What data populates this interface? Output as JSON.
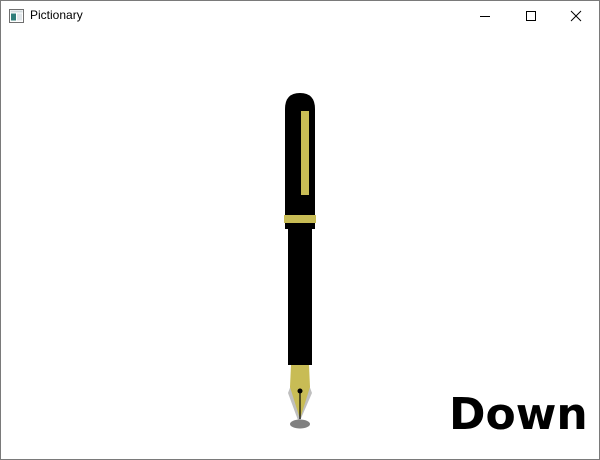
{
  "window": {
    "title": "Pictionary",
    "icons": {
      "app": "app-window-icon",
      "minimize": "minimize-icon",
      "maximize": "maximize-icon",
      "close": "close-icon"
    }
  },
  "canvas": {
    "pen_state": "Down",
    "pen_icon": "fountain-pen-icon",
    "colors": {
      "pen_body": "#000000",
      "pen_trim": "#c8bc55",
      "nib": "#c8bc55",
      "nib_shadow": "#bfbfbf",
      "ink_dot": "#808080"
    }
  }
}
